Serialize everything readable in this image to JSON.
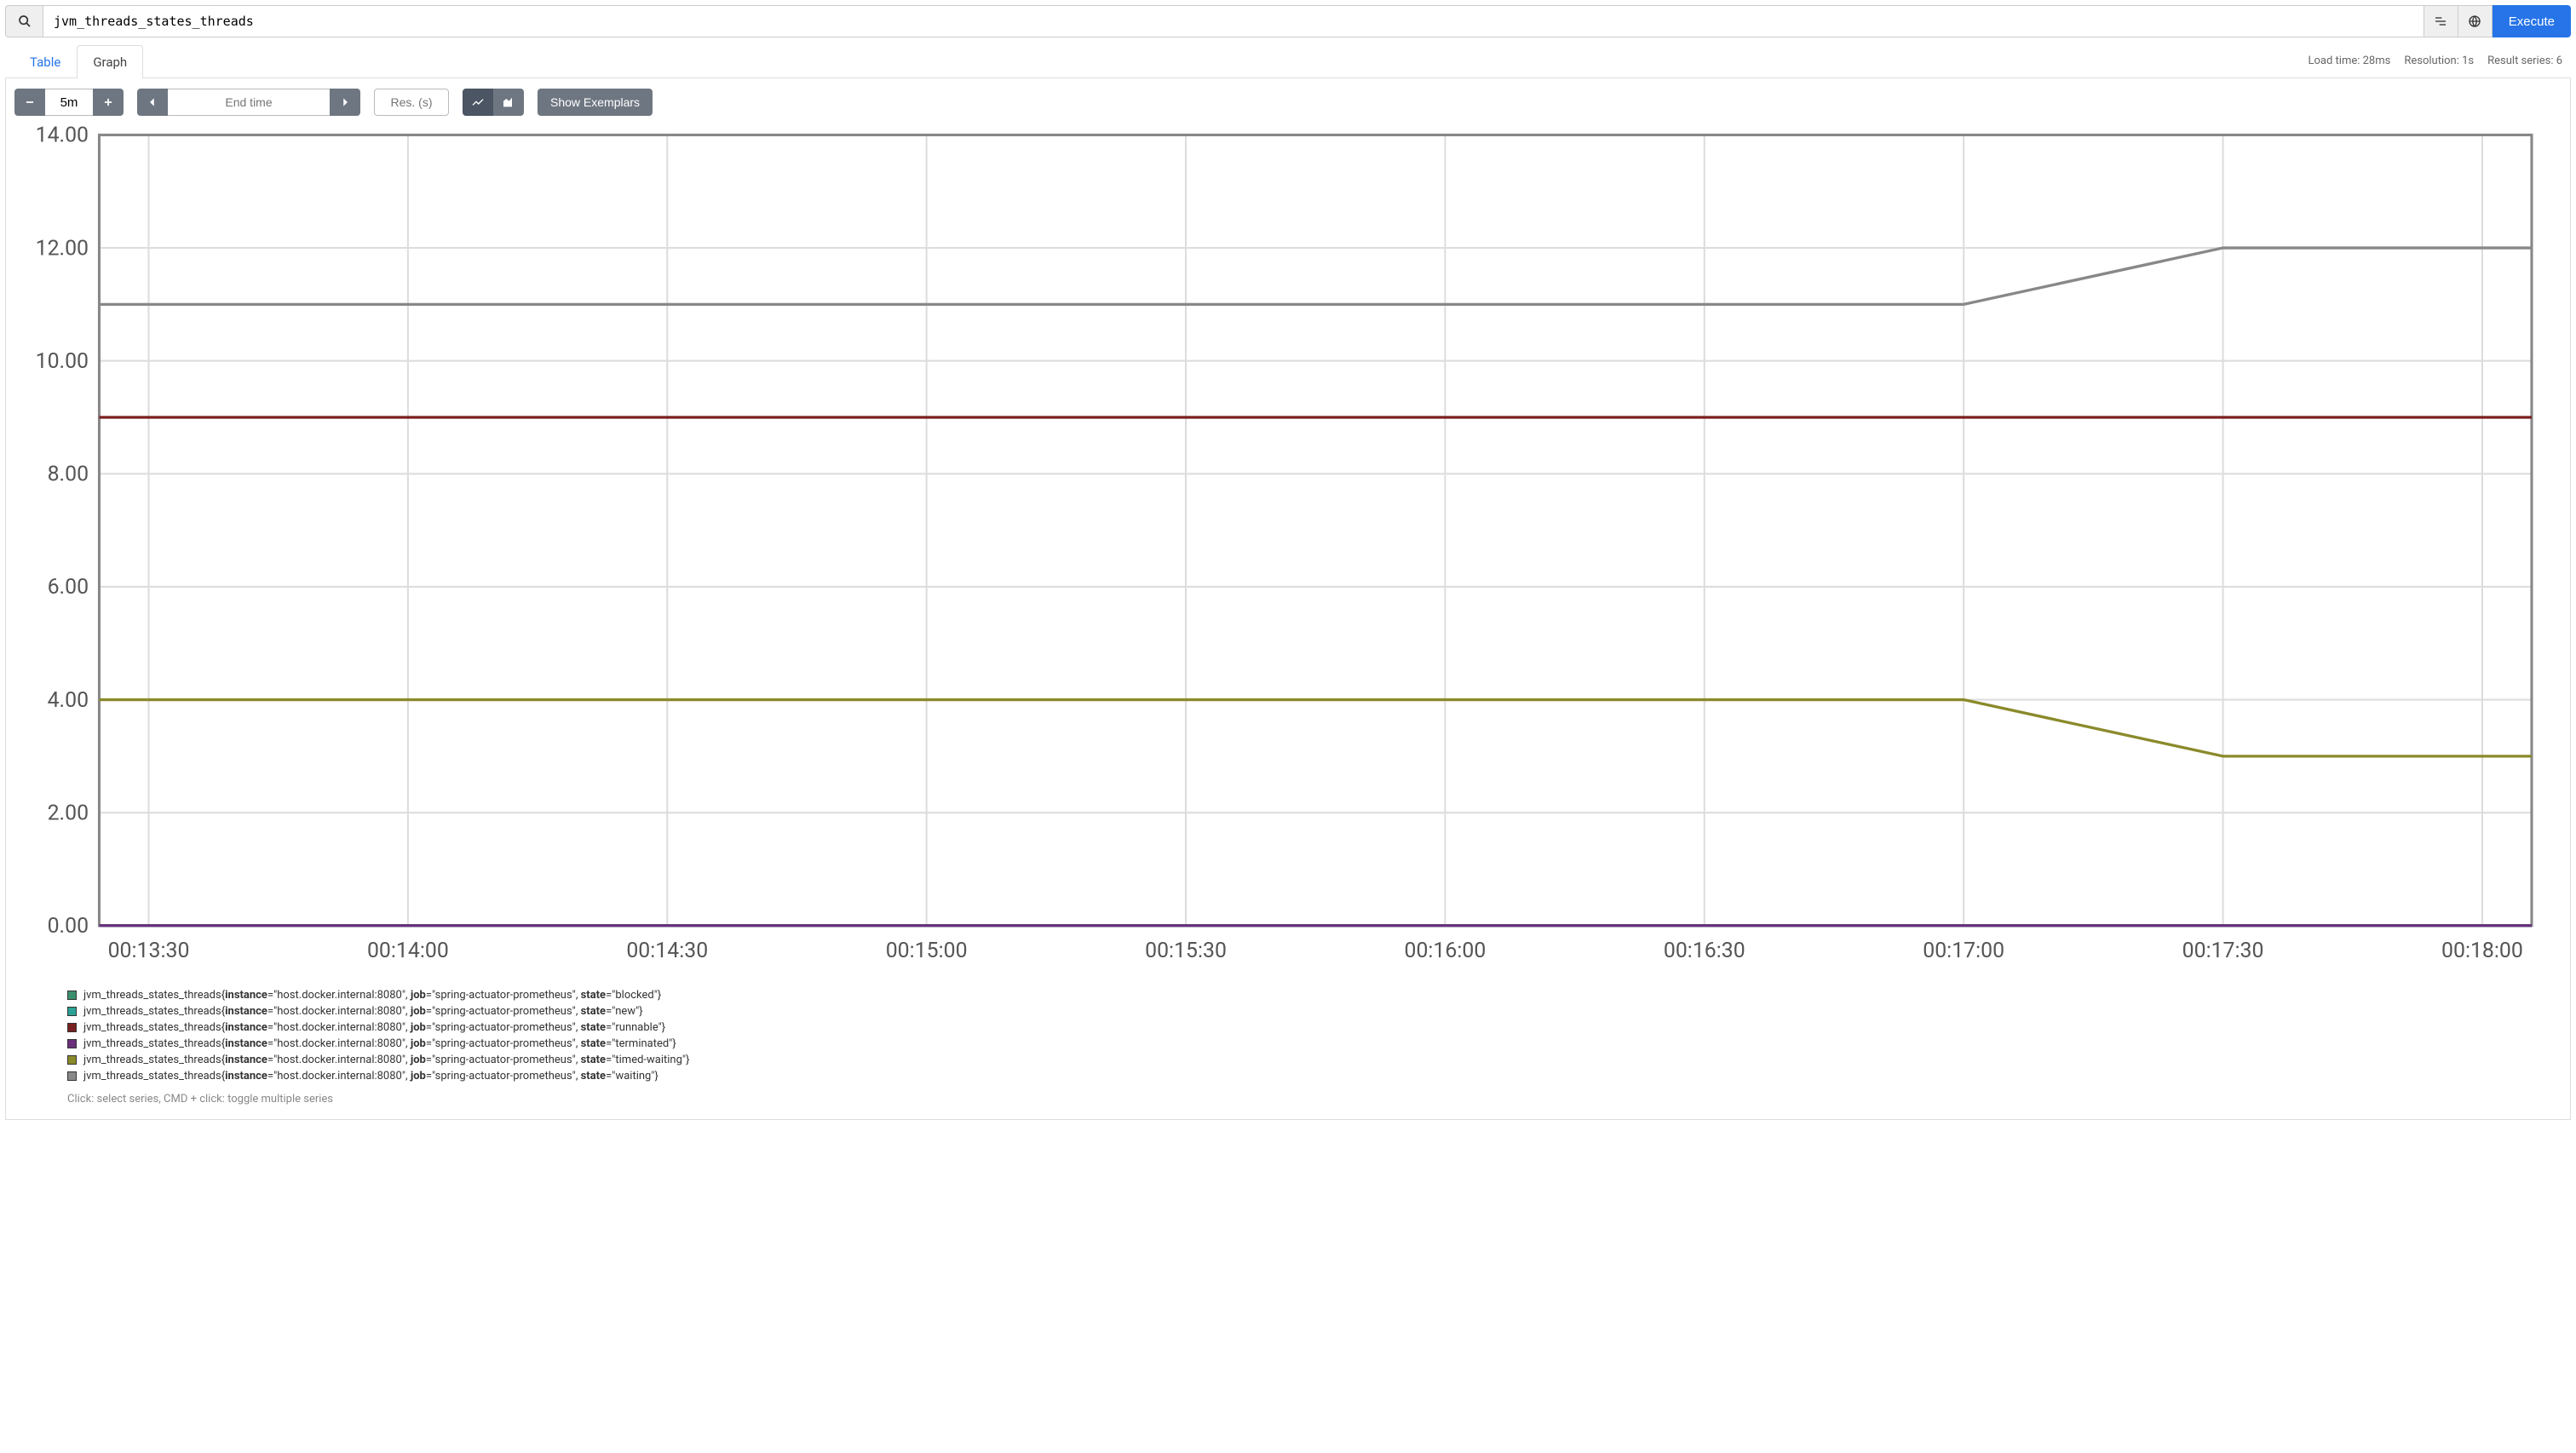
{
  "query": {
    "expression": "jvm_threads_states_threads",
    "execute_label": "Execute"
  },
  "tabs": {
    "table": "Table",
    "graph": "Graph"
  },
  "status": {
    "load_time": "Load time: 28ms",
    "resolution": "Resolution: 1s",
    "result_series": "Result series: 6"
  },
  "controls": {
    "duration": "5m",
    "end_time_placeholder": "End time",
    "resolution_placeholder": "Res. (s)",
    "show_exemplars": "Show Exemplars"
  },
  "chart_data": {
    "type": "line",
    "xlabel": "",
    "ylabel": "",
    "ylim": [
      0,
      14
    ],
    "y_ticks": [
      0,
      2,
      4,
      6,
      8,
      10,
      12,
      14
    ],
    "y_tick_labels": [
      "0.00",
      "2.00",
      "4.00",
      "6.00",
      "8.00",
      "10.00",
      "12.00",
      "14.00"
    ],
    "x_categories": [
      "00:13:30",
      "00:14:00",
      "00:14:30",
      "00:15:00",
      "00:15:30",
      "00:16:00",
      "00:16:30",
      "00:17:00",
      "00:17:30",
      "00:18:00"
    ],
    "series": [
      {
        "name": "blocked",
        "color": "#3b8f6e",
        "values": [
          0,
          0,
          0,
          0,
          0,
          0,
          0,
          0,
          0,
          0
        ]
      },
      {
        "name": "new",
        "color": "#2aa296",
        "values": [
          0,
          0,
          0,
          0,
          0,
          0,
          0,
          0,
          0,
          0
        ]
      },
      {
        "name": "runnable",
        "color": "#7a1f1f",
        "values": [
          9,
          9,
          9,
          9,
          9,
          9,
          9,
          9,
          9,
          9
        ]
      },
      {
        "name": "terminated",
        "color": "#6b2f7a",
        "values": [
          0,
          0,
          0,
          0,
          0,
          0,
          0,
          0,
          0,
          0
        ]
      },
      {
        "name": "timed-waiting",
        "color": "#8a8a2b",
        "values": [
          4,
          4,
          4,
          4,
          4,
          4,
          4,
          4,
          3,
          3
        ]
      },
      {
        "name": "waiting",
        "color": "#888888",
        "values": [
          11,
          11,
          11,
          11,
          11,
          11,
          11,
          11,
          12,
          12
        ]
      }
    ]
  },
  "legend": {
    "metric": "jvm_threads_states_threads",
    "instance_key": "instance",
    "instance_val": "\"host.docker.internal:8080\"",
    "job_key": "job",
    "job_val": "\"spring-actuator-prometheus\"",
    "state_key": "state",
    "items": [
      {
        "state": "\"blocked\"",
        "color": "#3b8f6e"
      },
      {
        "state": "\"new\"",
        "color": "#2aa296"
      },
      {
        "state": "\"runnable\"",
        "color": "#7a1f1f"
      },
      {
        "state": "\"terminated\"",
        "color": "#6b2f7a"
      },
      {
        "state": "\"timed-waiting\"",
        "color": "#8a8a2b"
      },
      {
        "state": "\"waiting\"",
        "color": "#888888"
      }
    ],
    "hint": "Click: select series, CMD + click: toggle multiple series"
  }
}
